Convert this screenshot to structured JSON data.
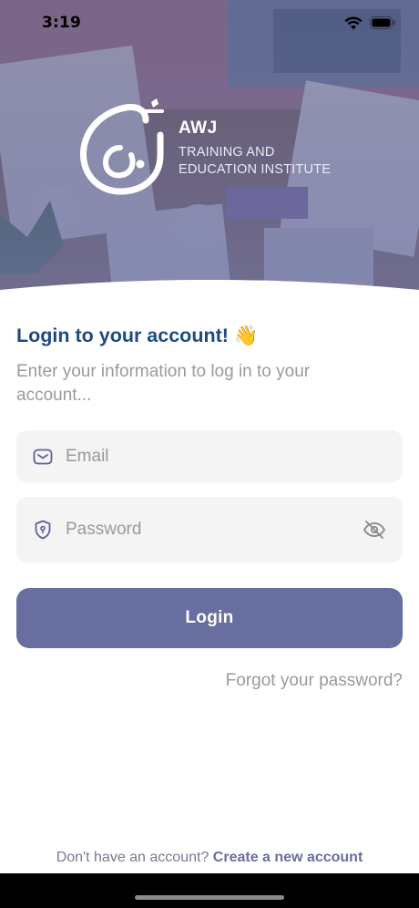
{
  "status_bar": {
    "time": "3:19"
  },
  "brand": {
    "name": "AWJ",
    "subtitle_line1": "TRAINING AND",
    "subtitle_line2": "EDUCATION INSTITUTE"
  },
  "login": {
    "heading": "Login to your account!",
    "heading_emoji": "👋",
    "subtext": "Enter your information to log in to your account..."
  },
  "form": {
    "email": {
      "placeholder": "Email",
      "value": ""
    },
    "password": {
      "placeholder": "Password",
      "value": ""
    },
    "login_label": "Login",
    "forgot_label": "Forgot your password?"
  },
  "signup": {
    "prompt": "Don't have an account?",
    "link_label": "Create a new account"
  },
  "icons": {
    "status": [
      "wifi-icon",
      "battery-icon"
    ],
    "email": "mail-icon",
    "password": "shield-lock-icon",
    "toggle": "eye-off-icon"
  },
  "colors": {
    "primary": "#686e9f",
    "heading": "#1e4a82",
    "muted_text": "#9a9a9a",
    "field_bg": "#f4f4f4"
  }
}
